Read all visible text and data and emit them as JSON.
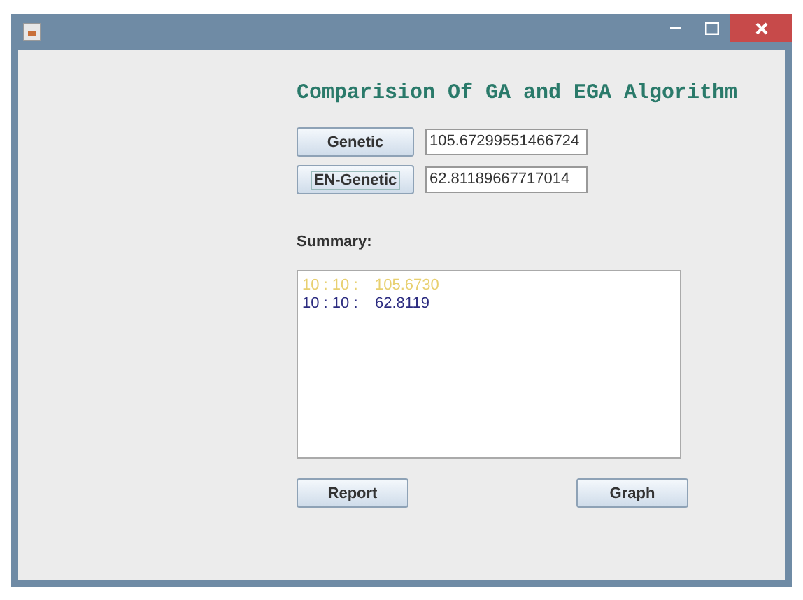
{
  "title": "Comparision Of GA and EGA Algorithm",
  "runs": [
    {
      "button": "Genetic",
      "value": "105.67299551466724",
      "focused": false
    },
    {
      "button": "EN-Genetic",
      "value": "62.81189667717014",
      "focused": true
    }
  ],
  "summary": {
    "label": "Summary:",
    "lines": [
      {
        "time": "10 : 10 :",
        "value": "105.6730",
        "color": "#e8d070"
      },
      {
        "time": "10 : 10 :",
        "value": "62.8119",
        "color": "#2c2c80"
      }
    ]
  },
  "buttons": [
    "Report",
    "Graph"
  ]
}
